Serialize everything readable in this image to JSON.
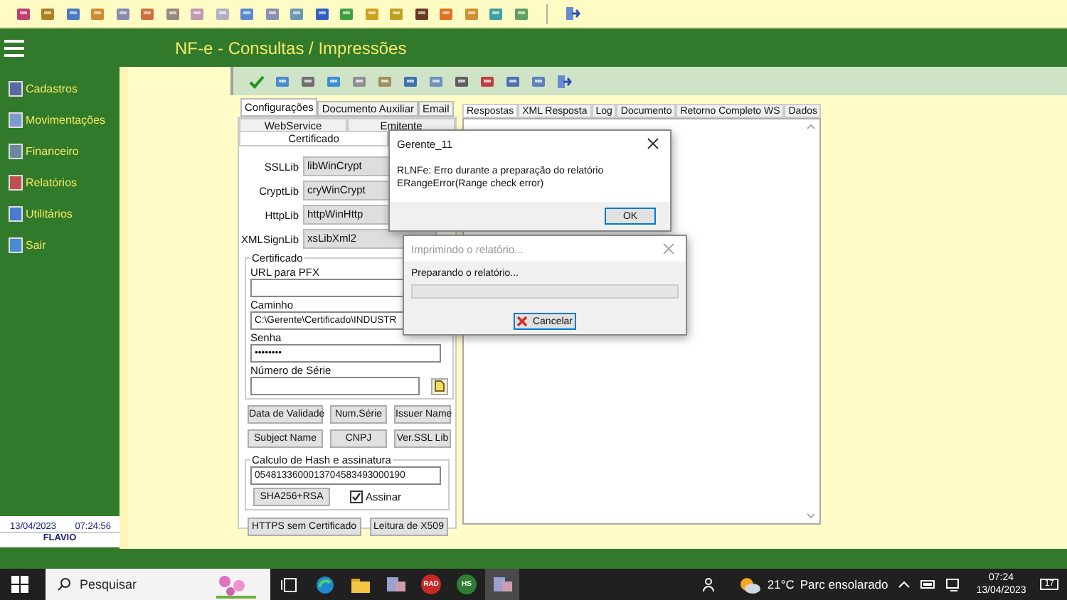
{
  "header": {
    "title": "NF-e - Consultas / Impressões"
  },
  "sidebar": {
    "items": [
      {
        "label": "Cadastros"
      },
      {
        "label": "Movimentações"
      },
      {
        "label": "Financeiro"
      },
      {
        "label": "Relatórios"
      },
      {
        "label": "Utilitários"
      },
      {
        "label": "Sair"
      }
    ],
    "date": "13/04/2023",
    "time": "07:24:56",
    "user": "FLAVIO"
  },
  "main_tabs": [
    {
      "label": "Configurações",
      "selected": true
    },
    {
      "label": "Documento Auxiliar",
      "selected": false
    },
    {
      "label": "Email",
      "selected": false
    }
  ],
  "sub_tabs": [
    {
      "label": "WebService",
      "selected": false
    },
    {
      "label": "Emitente",
      "selected": false
    }
  ],
  "active_sub_tab": {
    "label": "Certificado",
    "selected": true
  },
  "libs": [
    {
      "label": "SSLLib",
      "value": "libWinCrypt"
    },
    {
      "label": "CryptLib",
      "value": "cryWinCrypt"
    },
    {
      "label": "HttpLib",
      "value": "httpWinHttp"
    },
    {
      "label": "XMLSignLib",
      "value": "xsLibXml2"
    }
  ],
  "certificate": {
    "title": "Certificado",
    "fields": [
      {
        "label": "URL para PFX",
        "kind": "text"
      },
      {
        "label": "Caminho",
        "kind": "text",
        "value": "C:\\Gerente\\Certificado\\INDUSTR"
      },
      {
        "label": "Senha",
        "kind": "text",
        "value": "••••••••"
      },
      {
        "label": "Número de Série",
        "kind": "lookup"
      }
    ]
  },
  "cert_buttons": [
    "Data de Validade",
    "Num.Série",
    "Issuer Name",
    "Subject Name",
    "CNPJ",
    "Ver.SSL Lib"
  ],
  "hash": {
    "title": "Calculo de Hash e assinatura",
    "value": "0548133600013704583493000190",
    "button": "SHA256+RSA",
    "sign": {
      "label": "Assinar",
      "checked": true
    }
  },
  "bottom_buttons": [
    "HTTPS sem Certificado",
    "Leitura de X509"
  ],
  "result_tabs": [
    {
      "label": "Respostas",
      "selected": true
    },
    {
      "label": "XML Resposta",
      "selected": false
    },
    {
      "label": "Log",
      "selected": false
    },
    {
      "label": "Documento",
      "selected": false
    },
    {
      "label": "Retorno Completo WS",
      "selected": false
    },
    {
      "label": "Dados",
      "selected": false
    }
  ],
  "error_dialog": {
    "title": "Gerente_11",
    "lines": [
      "RLNFe: Erro durante a preparação do relatório",
      "ERangeError(Range check error)"
    ],
    "button": "OK"
  },
  "progress_dialog": {
    "title": "Imprimindo o relatório...",
    "message": "Preparando o relatório...",
    "level": 0,
    "button": "Cancelar"
  },
  "taskbar": {
    "search": {
      "placeholder": "Pesquisar"
    },
    "apps": [
      {
        "kind": "taskview",
        "active": false
      },
      {
        "kind": "browser",
        "active": false
      },
      {
        "kind": "folder",
        "active": false
      },
      {
        "kind": "window",
        "active": false
      },
      {
        "kind": "badge",
        "label": "RAD",
        "color": "#c62828",
        "active": false
      },
      {
        "kind": "badge",
        "label": "HS",
        "color": "#2e7d32",
        "active": false
      },
      {
        "kind": "window",
        "active": true
      }
    ],
    "weather": {
      "temperature": "21°C",
      "text": "Parc ensolarado"
    },
    "time": "07:24",
    "date": "13/04/2023",
    "notifications": "17"
  }
}
